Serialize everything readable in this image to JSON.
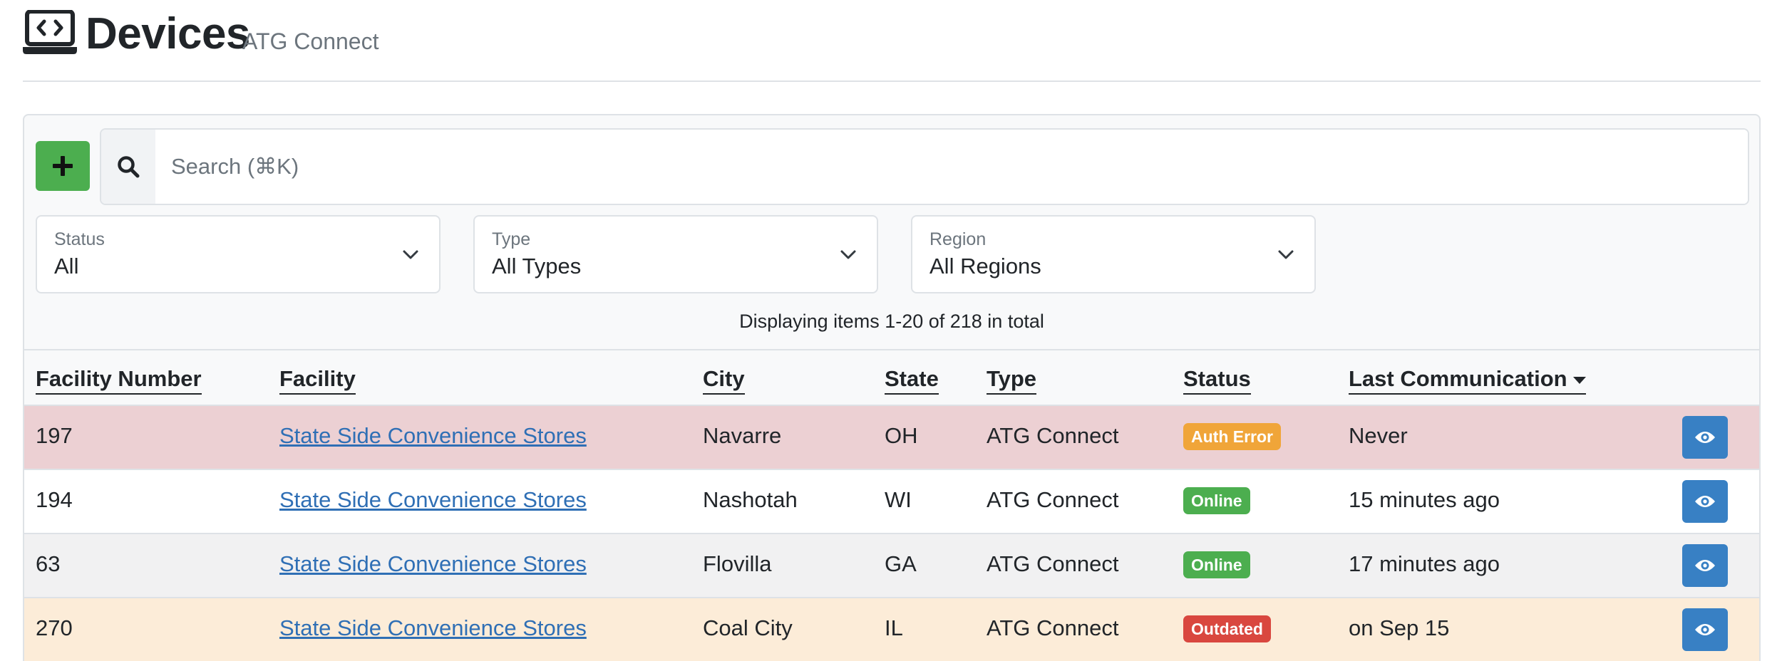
{
  "header": {
    "icon": "laptop-code-icon",
    "title": "Devices",
    "subtitle": "ATG Connect"
  },
  "toolbar": {
    "add_icon": "plus-icon",
    "search_icon": "search-icon",
    "search_placeholder": "Search (⌘K)",
    "search_value": ""
  },
  "filters": [
    {
      "label": "Status",
      "value": "All"
    },
    {
      "label": "Type",
      "value": "All Types"
    },
    {
      "label": "Region",
      "value": "All Regions"
    }
  ],
  "pagination": {
    "summary": "Displaying items 1-20 of 218 in total"
  },
  "table": {
    "columns": {
      "facility_number": "Facility Number",
      "facility": "Facility",
      "city": "City",
      "state": "State",
      "type": "Type",
      "status": "Status",
      "last_communication": "Last Communication"
    },
    "sorted_column": "last_communication",
    "sort_direction": "descending",
    "rows": [
      {
        "facility_number": "197",
        "facility": "State Side Convenience Stores",
        "city": "Navarre",
        "state": "OH",
        "type": "ATG Connect",
        "status": "Auth Error",
        "last_communication": "Never",
        "row_color": "#ecd0d3",
        "status_color": "#f0a539"
      },
      {
        "facility_number": "194",
        "facility": "State Side Convenience Stores",
        "city": "Nashotah",
        "state": "WI",
        "type": "ATG Connect",
        "status": "Online",
        "last_communication": "15 minutes ago",
        "row_color": "#ffffff",
        "status_color": "#4cae4f"
      },
      {
        "facility_number": "63",
        "facility": "State Side Convenience Stores",
        "city": "Flovilla",
        "state": "GA",
        "type": "ATG Connect",
        "status": "Online",
        "last_communication": "17 minutes ago",
        "row_color": "#f1f1f2",
        "status_color": "#4cae4f"
      },
      {
        "facility_number": "270",
        "facility": "State Side Convenience Stores",
        "city": "Coal City",
        "state": "IL",
        "type": "ATG Connect",
        "status": "Outdated",
        "last_communication": "on Sep 15",
        "row_color": "#fcecd8",
        "status_color": "#d9473f"
      }
    ],
    "row_action_icon": "eye-icon"
  },
  "colors": {
    "add_button": "#4cae4f",
    "view_button": "#3880c4",
    "link": "#2f6fb5"
  }
}
